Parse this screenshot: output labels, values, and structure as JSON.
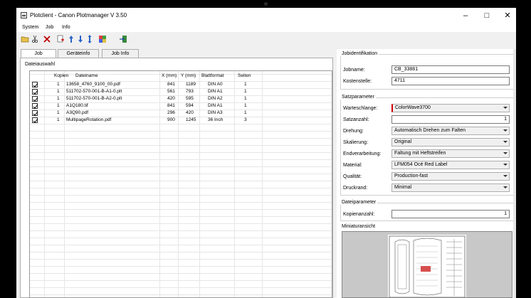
{
  "window": {
    "title": "Plotclient - Canon Plotmanager V 3.50"
  },
  "menu": [
    "System",
    "Job",
    "Info"
  ],
  "toolbar": [
    "open-icon",
    "cut-icon",
    "delete-icon",
    "add-icon",
    "move-up-icon",
    "move-down-icon",
    "sort-icon",
    "settings-icon",
    "exit-icon"
  ],
  "tabs": [
    "Job",
    "Geräteinfo",
    "Job Info"
  ],
  "file_group": {
    "label": "Dateiauswahl",
    "columns": [
      "Kopien",
      "Dateiname",
      "X (mm)",
      "Y (mm)",
      "Blattformat",
      "Seiten"
    ],
    "rows": [
      {
        "kopien": "1",
        "name": "13658_4760_9100_00.pdf",
        "x": "841",
        "y": "1189",
        "format": "DIN A0",
        "seiten": "1"
      },
      {
        "kopien": "1",
        "name": "511702-570-001-B-A1-0.plt",
        "x": "561",
        "y": "793",
        "format": "DIN A1",
        "seiten": "1"
      },
      {
        "kopien": "1",
        "name": "511702-570-001-B-A2-0.plt",
        "x": "420",
        "y": "595",
        "format": "DIN A2",
        "seiten": "1"
      },
      {
        "kopien": "1",
        "name": "A1Q180.tif",
        "x": "841",
        "y": "594",
        "format": "DIN A1",
        "seiten": "1"
      },
      {
        "kopien": "1",
        "name": "A3Q90.pdf",
        "x": "296",
        "y": "420",
        "format": "DIN A3",
        "seiten": "1"
      },
      {
        "kopien": "1",
        "name": "MultipageRotation.pdf",
        "x": "900",
        "y": "1245",
        "format": "36 Inch",
        "seiten": "3"
      }
    ]
  },
  "job_id": {
    "title": "Jobidentifikation",
    "jobname_label": "Jobname:",
    "jobname_value": "CB_33881",
    "kostenstelle_label": "Kostenstelle:",
    "kostenstelle_value": "4711"
  },
  "satz": {
    "title": "Satzparameter",
    "warteschlange_label": "Warteschlange:",
    "warteschlange_value": "ColorWave3700",
    "satzanzahl_label": "Satzanzahl:",
    "satzanzahl_value": "1",
    "drehung_label": "Drehung:",
    "drehung_value": "Automatisch Drehen zum Falten",
    "skalierung_label": "Skalierung:",
    "skalierung_value": "Original",
    "endverarbeitung_label": "Endverarbeitung:",
    "endverarbeitung_value": "Faltung mit Heftstreifen",
    "material_label": "Material:",
    "material_value": "LFM054 Océ Red Label",
    "qualitaet_label": "Qualität:",
    "qualitaet_value": "Production-fast",
    "druckrand_label": "Druckrand:",
    "druckrand_value": "Minimal"
  },
  "datei": {
    "title": "Dateiparameter",
    "kopienanzahl_label": "Kopienanzahl:",
    "kopienanzahl_value": "1"
  },
  "preview": {
    "title": "Miniaturansicht"
  },
  "colors": {
    "accent_red": "#d00000",
    "window_bg": "#f0f0f0"
  }
}
